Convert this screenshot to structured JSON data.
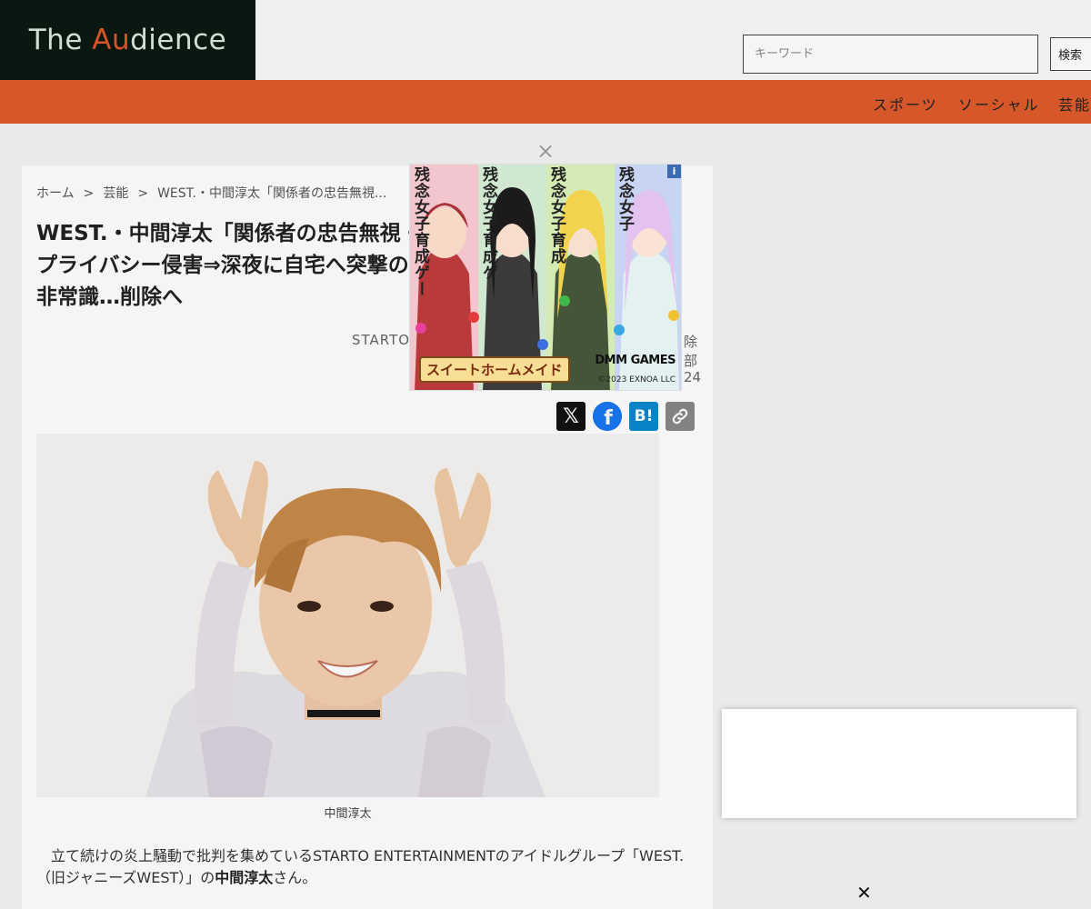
{
  "header": {
    "logo_part1": "The ",
    "logo_accent": "Au",
    "logo_part2": "dience",
    "search_placeholder": "キーワード",
    "search_button": "検索",
    "logo_color": "#0b1a12",
    "accent_color": "#e2572b"
  },
  "nav": {
    "items": [
      "スポーツ",
      "ソーシャル",
      "芸能"
    ],
    "color": "#df5b2c"
  },
  "breadcrumb": {
    "home": "ホーム",
    "category": "芸能",
    "current": "WEST.・中間淳太「関係者の忠告無視...",
    "separator": ">"
  },
  "article": {
    "title": "WEST.・中間淳太「関係者の忠告無視・プライバシー侵害⇒深夜に自宅へ突撃の非常識…削除へ",
    "meta_left": "STARTO",
    "meta_right_1": "除",
    "meta_right_2": "部",
    "meta_right_3": "24",
    "caption": "中間淳太",
    "body_plain_1": "立て続けの炎上騒動で批判を集めているSTARTO ENTERTAINMENTのアイドルグループ「WEST.（旧ジャニーズWEST）」の",
    "body_bold": "中間淳太",
    "body_plain_2": "さん。"
  },
  "share": {
    "x_icon": "𝕏",
    "facebook_icon": "f",
    "hatena_icon": "B!",
    "link_icon": "🔗"
  },
  "ad": {
    "close_glyph": "×",
    "info_glyph": "i",
    "panel_labels": [
      "残念女子育成ゲー",
      "残念女子育成ゲ",
      "残念女子育成",
      "残念女子"
    ],
    "game_title": "スイートホームメイド",
    "brand": "DMM GAMES",
    "copyright": "©2023 EXNOA LLC",
    "panel_colors": [
      "#f3c6cf",
      "#cfe8cf",
      "#d4ecb4",
      "#c7d4f2"
    ]
  },
  "float": {
    "close_glyph": "✕"
  }
}
